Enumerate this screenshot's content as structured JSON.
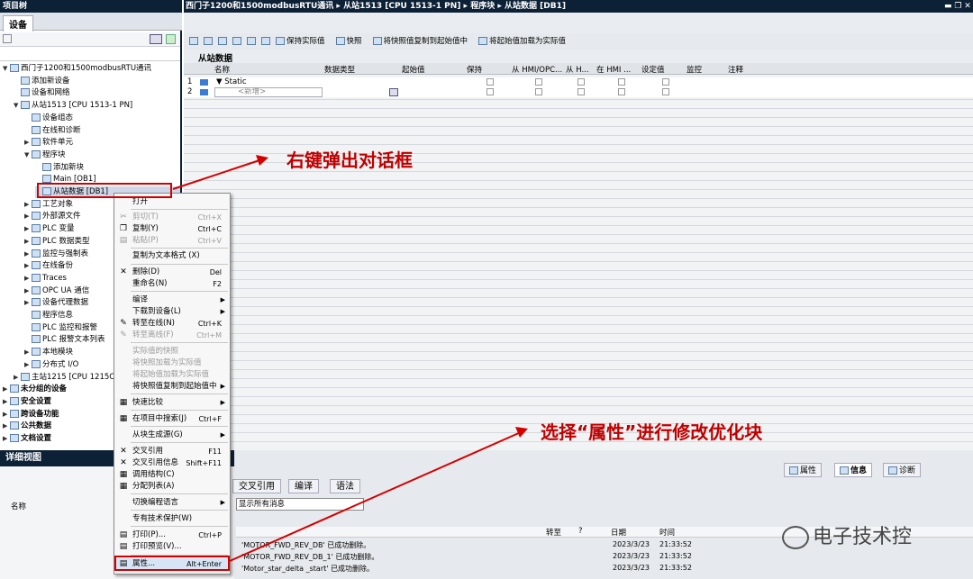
{
  "left_title": "项目树",
  "device_tab": "设备",
  "main_title": "西门子1200和1500modbusRTU通讯 ▸ 从站1513 [CPU 1513-1 PN] ▸ 程序块 ▸ 从站数据 [DB1]",
  "tree": [
    {
      "label": "西门子1200和1500modbusRTU通讯",
      "level": 0,
      "arrow": "▼"
    },
    {
      "label": "添加新设备",
      "level": 1,
      "arrow": ""
    },
    {
      "label": "设备和网络",
      "level": 1,
      "arrow": ""
    },
    {
      "label": "从站1513 [CPU 1513-1 PN]",
      "level": 1,
      "arrow": "▼"
    },
    {
      "label": "设备组态",
      "level": 2,
      "arrow": ""
    },
    {
      "label": "在线和诊断",
      "level": 2,
      "arrow": ""
    },
    {
      "label": "软件单元",
      "level": 2,
      "arrow": "▶"
    },
    {
      "label": "程序块",
      "level": 2,
      "arrow": "▼"
    },
    {
      "label": "添加新块",
      "level": 3,
      "arrow": ""
    },
    {
      "label": "Main [OB1]",
      "level": 3,
      "arrow": ""
    },
    {
      "label": "从站数据 [DB1]",
      "level": 3,
      "arrow": ""
    },
    {
      "label": "工艺对象",
      "level": 2,
      "arrow": "▶"
    },
    {
      "label": "外部源文件",
      "level": 2,
      "arrow": "▶"
    },
    {
      "label": "PLC 变量",
      "level": 2,
      "arrow": "▶"
    },
    {
      "label": "PLC 数据类型",
      "level": 2,
      "arrow": "▶"
    },
    {
      "label": "监控与强制表",
      "level": 2,
      "arrow": "▶"
    },
    {
      "label": "在线备份",
      "level": 2,
      "arrow": "▶"
    },
    {
      "label": "Traces",
      "level": 2,
      "arrow": "▶"
    },
    {
      "label": "OPC UA 通信",
      "level": 2,
      "arrow": "▶"
    },
    {
      "label": "设备代理数据",
      "level": 2,
      "arrow": "▶"
    },
    {
      "label": "程序信息",
      "level": 2,
      "arrow": ""
    },
    {
      "label": "PLC 监控和报警",
      "level": 2,
      "arrow": ""
    },
    {
      "label": "PLC 报警文本列表",
      "level": 2,
      "arrow": ""
    },
    {
      "label": "本地模块",
      "level": 2,
      "arrow": "▶"
    },
    {
      "label": "分布式 I/O",
      "level": 2,
      "arrow": "▶"
    },
    {
      "label": "主站1215 [CPU 1215C",
      "level": 1,
      "arrow": "▶"
    },
    {
      "label": "未分组的设备",
      "level": 0,
      "arrow": "▶"
    },
    {
      "label": "安全设置",
      "level": 0,
      "arrow": "▶"
    },
    {
      "label": "跨设备功能",
      "level": 0,
      "arrow": "▶"
    },
    {
      "label": "公共数据",
      "level": 0,
      "arrow": "▶"
    },
    {
      "label": "文档设置",
      "level": 0,
      "arrow": "▶"
    }
  ],
  "toolbar": [
    "保持实际值",
    "快照",
    "将快照值复制到起始值中",
    "将起始值加载为实际值"
  ],
  "db_title": "从站数据",
  "grid_headers": [
    "名称",
    "数据类型",
    "起始值",
    "保持",
    "从 HMI/OPC...",
    "从 H...",
    "在 HMI ...",
    "设定值",
    "监控",
    "注释"
  ],
  "grid_rows": [
    {
      "num": "1",
      "name": "▼ Static"
    },
    {
      "num": "2",
      "name": "<新增>"
    }
  ],
  "detail_title": "详细视图",
  "detail_name_header": "名称",
  "bottom_tabs": [
    "交叉引用",
    "编译",
    "语法"
  ],
  "filter_value": "显示所有消息",
  "info_tabs": [
    "属性",
    "信息",
    "诊断"
  ],
  "msg_headers": [
    "转至",
    "?",
    "日期",
    "时间"
  ],
  "messages": [
    {
      "text": "'MOTOR_FWD_REV_DB' 已成功删除。",
      "date": "2023/3/23",
      "time": "21:33:52"
    },
    {
      "text": "'MOTOR_FWD_REV_DB_1' 已成功删除。",
      "date": "2023/3/23",
      "time": "21:33:52"
    },
    {
      "text": "'Motor_star_delta _start' 已成功删除。",
      "date": "2023/3/23",
      "time": "21:33:52"
    }
  ],
  "context_menu": [
    {
      "label": "打开",
      "shortcut": "",
      "disabled": false,
      "sub": false
    },
    {
      "label": "剪切(T)",
      "shortcut": "Ctrl+X",
      "disabled": true,
      "sub": false
    },
    {
      "label": "复制(Y)",
      "shortcut": "Ctrl+C",
      "disabled": false,
      "sub": false
    },
    {
      "label": "粘贴(P)",
      "shortcut": "Ctrl+V",
      "disabled": true,
      "sub": false
    },
    {
      "label": "复制为文本格式 (X)",
      "shortcut": "",
      "disabled": false,
      "sub": false
    },
    {
      "label": "删除(D)",
      "shortcut": "Del",
      "disabled": false,
      "sub": false
    },
    {
      "label": "重命名(N)",
      "shortcut": "F2",
      "disabled": false,
      "sub": false
    },
    {
      "label": "编译",
      "shortcut": "",
      "disabled": false,
      "sub": true
    },
    {
      "label": "下载到设备(L)",
      "shortcut": "",
      "disabled": false,
      "sub": true
    },
    {
      "label": "转至在线(N)",
      "shortcut": "Ctrl+K",
      "disabled": false,
      "sub": false
    },
    {
      "label": "转至离线(F)",
      "shortcut": "Ctrl+M",
      "disabled": true,
      "sub": false
    },
    {
      "label": "实际值的快照",
      "shortcut": "",
      "disabled": true,
      "sub": false
    },
    {
      "label": "将快照加载为实际值",
      "shortcut": "",
      "disabled": true,
      "sub": false
    },
    {
      "label": "将起始值加载为实际值",
      "shortcut": "",
      "disabled": true,
      "sub": false
    },
    {
      "label": "将快照值复制到起始值中",
      "shortcut": "",
      "disabled": false,
      "sub": true
    },
    {
      "label": "快速比较",
      "shortcut": "",
      "disabled": false,
      "sub": true
    },
    {
      "label": "在项目中搜索(J)",
      "shortcut": "Ctrl+F",
      "disabled": false,
      "sub": false
    },
    {
      "label": "从块生成源(G)",
      "shortcut": "",
      "disabled": false,
      "sub": true
    },
    {
      "label": "交叉引用",
      "shortcut": "F11",
      "disabled": false,
      "sub": false
    },
    {
      "label": "交叉引用信息",
      "shortcut": "Shift+F11",
      "disabled": false,
      "sub": false
    },
    {
      "label": "调用结构(C)",
      "shortcut": "",
      "disabled": false,
      "sub": false
    },
    {
      "label": "分配列表(A)",
      "shortcut": "",
      "disabled": false,
      "sub": false
    },
    {
      "label": "切换编程语言",
      "shortcut": "",
      "disabled": false,
      "sub": true
    },
    {
      "label": "专有技术保护(W)",
      "shortcut": "",
      "disabled": false,
      "sub": false
    },
    {
      "label": "打印(P)...",
      "shortcut": "Ctrl+P",
      "disabled": false,
      "sub": false
    },
    {
      "label": "打印预览(V)...",
      "shortcut": "",
      "disabled": false,
      "sub": false
    },
    {
      "label": "属性...",
      "shortcut": "Alt+Enter",
      "disabled": false,
      "sub": false
    }
  ],
  "annotation_1": "右键弹出对话框",
  "annotation_2": "选择“属性”进行修改优化块",
  "watermark": "电子技术控"
}
